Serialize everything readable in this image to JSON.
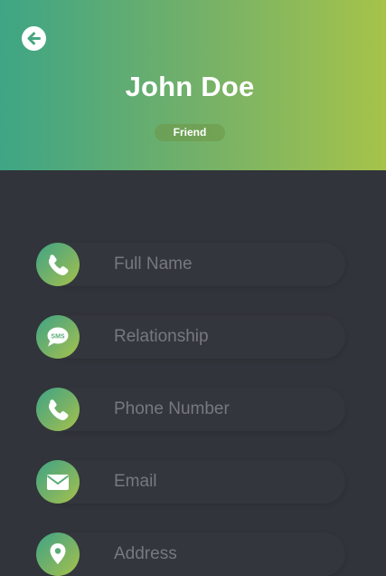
{
  "header": {
    "title": "John Doe",
    "badge": "Friend",
    "gradient": [
      "#3ea585",
      "#a6c34a"
    ]
  },
  "fields": [
    {
      "icon": "phone-icon",
      "placeholder": "Full Name",
      "value": ""
    },
    {
      "icon": "sms-icon",
      "icon_text": "SMS",
      "placeholder": "Relationship",
      "value": ""
    },
    {
      "icon": "phone-icon",
      "placeholder": "Phone Number",
      "value": ""
    },
    {
      "icon": "envelope-icon",
      "placeholder": "Email",
      "value": ""
    },
    {
      "icon": "map-pin-icon",
      "placeholder": "Address",
      "value": ""
    }
  ],
  "colors": {
    "background": "#31343a",
    "field": "#33363c",
    "placeholder": "#76797e",
    "text": "#ffffff"
  }
}
